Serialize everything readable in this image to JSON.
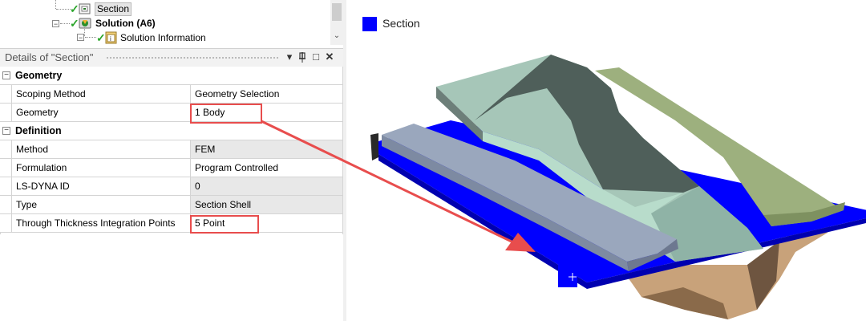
{
  "tree": {
    "nodes": [
      {
        "label": "Section",
        "bold": false
      },
      {
        "label": "Solution (A6)",
        "bold": true
      },
      {
        "label": "Solution Information",
        "bold": false
      }
    ]
  },
  "details": {
    "title": "Details of \"Section\"",
    "header_icons": {
      "dropdown": "▾",
      "pin": "Ⴤ",
      "maximize": "□",
      "close": "✕"
    }
  },
  "grid": {
    "categories": [
      {
        "label": "Geometry",
        "toggle": "−",
        "rows": [
          {
            "name": "Scoping Method",
            "value": "Geometry Selection"
          },
          {
            "name": "Geometry",
            "value": "1 Body"
          }
        ]
      },
      {
        "label": "Definition",
        "toggle": "−",
        "rows": [
          {
            "name": "Method",
            "value": "FEM"
          },
          {
            "name": "Formulation",
            "value": "Program Controlled"
          },
          {
            "name": "LS-DYNA ID",
            "value": "0"
          },
          {
            "name": "Type",
            "value": "Section Shell"
          },
          {
            "name": "Through Thickness Integration Points",
            "value": "5 Point"
          }
        ]
      }
    ]
  },
  "viewport": {
    "legend": {
      "label": "Section",
      "color": "#0000ff"
    },
    "colors": {
      "shell": "#0000ff",
      "punch": "#9aa7bd",
      "die": "#9ec2b2",
      "holder": "#9db07e",
      "lower_die": "#c8a27a"
    }
  },
  "annotation": {
    "color": "#e84d4d"
  }
}
